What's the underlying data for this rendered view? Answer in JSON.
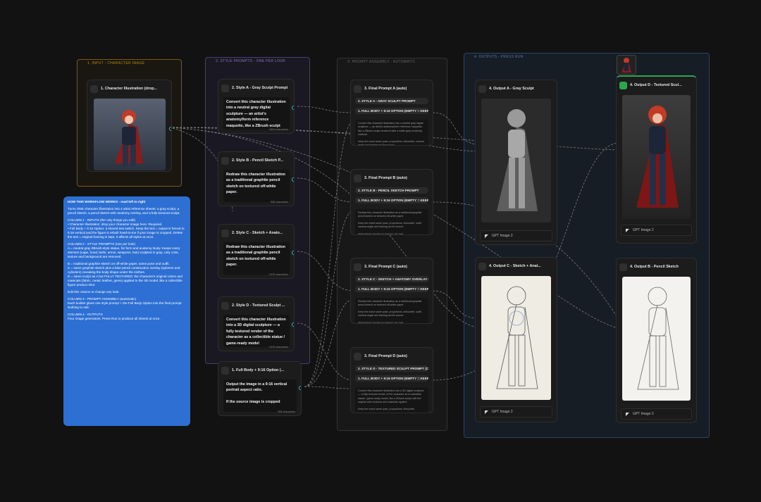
{
  "groups": {
    "input": "1. INPUT - CHARACTER IMAGE",
    "styles": "2. STYLE PROMPTS - ONE PER LOOK",
    "assembly": "3. PROMPT ASSEMBLY - AUTOMATIC",
    "outputs": "4. OUTPUTS - PRESS RUN"
  },
  "input_node": {
    "title": "1. Character Illustration (drop..."
  },
  "style_nodes": [
    {
      "title": "2. Style A - Gray Sculpt Prompt",
      "text": "Convert this character illustration into a neutral gray digital sculpture — an artist's anatomy/form reference maquette, like a ZBrush sculpt",
      "chars": "1804 characters"
    },
    {
      "title": "2. Style B - Pencil Sketch P...",
      "text": "Redraw this character illustration as a traditional graphite pencil sketch on textured off-white paper.",
      "chars": "908 characters"
    },
    {
      "title": "2. Style C - Sketch + Anato...",
      "text": "Redraw this character illustration as a traditional graphite pencil sketch on textured off-white paper.",
      "chars": "1076 characters"
    },
    {
      "title": "2. Style D - Textured Sculpt ...",
      "text": "Convert this character illustration into a 3D digital sculpture — a fully textured render of the character as a collectible statue / game-ready model",
      "chars": "1978 characters"
    }
  ],
  "option_node": {
    "title": "1. Full Body + 9:16 Option (...",
    "text": "Output the image in a 9:16 vertical portrait aspect ratio.\n\nIf the source image is cropped",
    "chars": "395 characters"
  },
  "combine_nodes": [
    {
      "title": "3. Final Prompt A (auto)",
      "p1": "2. STYLE A - GRAY SCULPT PROMPT",
      "p2": "1. FULL BODY + 9:16 OPTION (EMPTY = KEEP",
      "t1": "Convert this character illustration into a neutral gray digital sculpture — an artist's anatomy/form reference maquette, like a ZBrush sculpt rendered with a matte gray modeling material.",
      "t2": "Keep the exact same pose, proportions, silhouette, camera angle and framing as the source."
    },
    {
      "title": "3. Final Prompt B (auto)",
      "p1": "2. STYLE B - PENCIL SKETCH PROMPT",
      "p2": "1. FULL BODY + 9:16 OPTION (EMPTY = KEEP",
      "t1": "Redraw this character illustration as a traditional graphite pencil sketch on textured off-white paper.",
      "t2": "Keep the exact same pose, proportions, silhouette, outfit, camera angle and framing as the source.\n\nPRESERVE EVERY ELEMENT OF THE"
    },
    {
      "title": "3. Final Prompt C (auto)",
      "p1": "2. STYLE C - SKETCH + ANATOMY OVERLAY P",
      "p2": "1. FULL BODY + 9:16 OPTION (EMPTY = KEEP",
      "t1": "Redraw this character illustration as a traditional graphite pencil sketch on textured off-white paper.",
      "t2": "Keep the exact same pose, proportions, silhouette, outfit, camera angle and framing as the source.\n\nPRESERVE EVERY ELEMENT OF THE"
    },
    {
      "title": "3. Final Prompt D (auto)",
      "p1": "2. STYLE D - TEXTURED SCULPT PROMPT (C",
      "p2": "1. FULL BODY + 9:16 OPTION (EMPTY = KEEP",
      "t1": "Convert this character illustration into a 3D digital sculpture — a fully textured render of the character as a collectible statue / game-ready model, like a ZBrush sculpt with the original color textures and materials applied.",
      "t2": "Keep the exact same pose, proportions, silhouette,"
    }
  ],
  "output_nodes": [
    {
      "title": "4. Output A - Gray Sculpt",
      "gen": "GPT Image 2"
    },
    {
      "title": "4. Output D - Textured Scul...",
      "gen": "GPT Image 2"
    },
    {
      "title": "4. Output C - Sketch + Anat...",
      "gen": "GPT Image 2"
    },
    {
      "title": "4. Output B - Pencil Sketch",
      "gen": "GPT Image 2"
    }
  ],
  "help": {
    "heading": "HOW THIS WORKFLOW WORKS - read left to right",
    "intro": "Turns ONE character illustration into 4 artist reference sheets: a gray sculpt, a pencil sketch, a pencil sketch with anatomy overlay, and a fully textured sculpt.",
    "c1": "COLUMN 1 - INPUTS (the only things you edit)\n•  Character Illustration: drop your character image here. Required.\n• Full Body + 9:16 Option: a shared text switch. Keep the text = output is forced to 9:16 vertical and the figure is rebuilt head-to-toe if your image is cropped. Delete the text = original framing is kept. It affects all styles at once.",
    "c2": "COLUMN 2 - STYLE PROMPTS (one per look)\nA = neutral gray ZBrush-style statue, for form and anatomy study. Keeps every element (cape, hood, belts, armor, weapons, hair) sculpted in gray; only color, texture and background are removed.",
    "c2b": "B = traditional graphite sketch on off-white paper, same pose and outfit.\nC = same graphite sketch plus a blue-pencil construction overlay (spheres and cylinders) revealing the body shape under the clothes.\nD = same sculpt as A but FULLY TEXTURED: the character's original colors and materials (fabric, metal, leather, gems) applied to the 3D model, like a collectible figure product shot.",
    "edit": "Edit this column to change any look.",
    "c3": "COLUMN 3 - PROMPT ASSEMBLY (automatic)\nEach builder glues one style prompt + the Full Body Option into the final prompt. Nothing to edit.",
    "c4": "COLUMN 4 - OUTPUTS\nFour image generators. Press Run to produce all sheets at once."
  },
  "colors": {
    "canvas": "#121212",
    "input_group": "#b7860b",
    "style_group": "#5b4c8c",
    "assembly_group": "#3a3a3a",
    "output_group": "#2f4d75",
    "help_note": "#2d6fd3",
    "link": "#9a9a9a",
    "port": "#44bbbb"
  }
}
